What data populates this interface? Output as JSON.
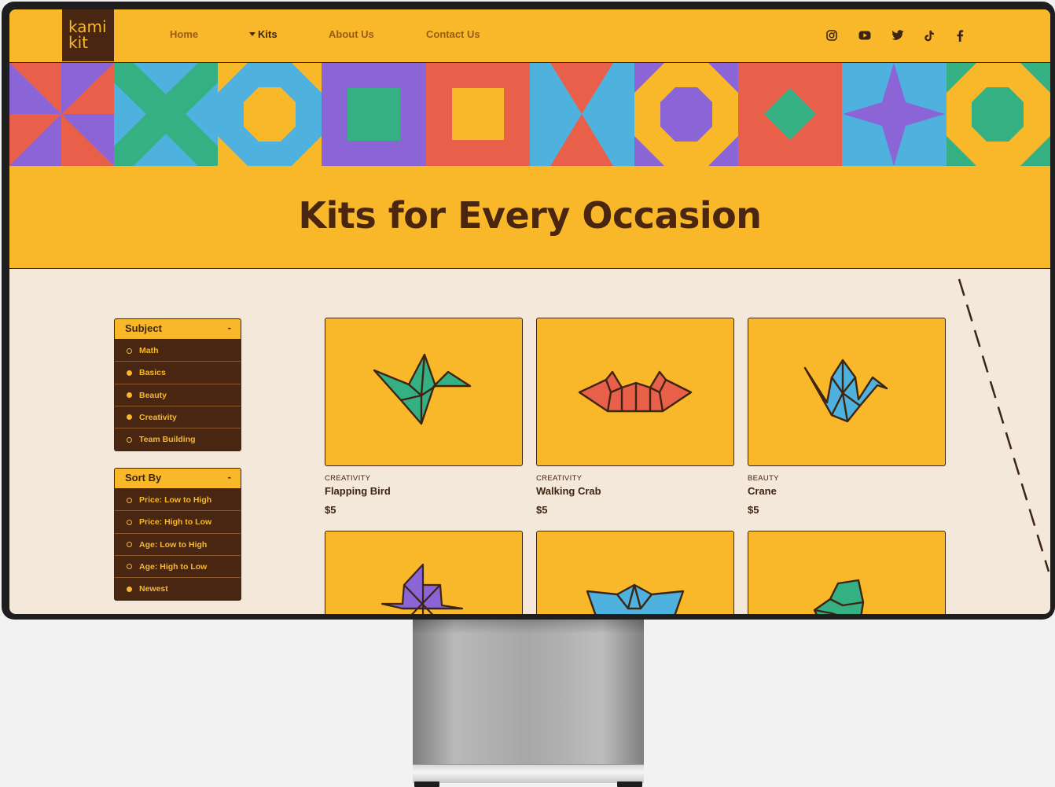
{
  "brand": {
    "logo_line1": "kami",
    "logo_line2": "kit"
  },
  "nav": {
    "links": [
      "Home",
      "Kits",
      "About Us",
      "Contact Us"
    ],
    "active": "Kits",
    "social_icons": [
      "instagram-icon",
      "youtube-icon",
      "twitter-icon",
      "tiktok-icon",
      "facebook-icon"
    ]
  },
  "headline": "Kits for Every Occasion",
  "filters": {
    "subject": {
      "title": "Subject",
      "toggle": "-",
      "options": [
        {
          "label": "Math",
          "selected": false
        },
        {
          "label": "Basics",
          "selected": true
        },
        {
          "label": "Beauty",
          "selected": true
        },
        {
          "label": "Creativity",
          "selected": true
        },
        {
          "label": "Team Building",
          "selected": false
        }
      ]
    },
    "sort": {
      "title": "Sort By",
      "toggle": "-",
      "options": [
        {
          "label": "Price: Low to High",
          "selected": false
        },
        {
          "label": "Price: High to Low",
          "selected": false
        },
        {
          "label": "Age: Low to High",
          "selected": false
        },
        {
          "label": "Age: High to Low",
          "selected": false
        },
        {
          "label": "Newest",
          "selected": true
        }
      ]
    }
  },
  "products": [
    {
      "category": "CREATIVITY",
      "name": "Flapping Bird",
      "price": "$5",
      "icon": "origami-bird-icon",
      "color": "#34b083"
    },
    {
      "category": "CREATIVITY",
      "name": "Walking Crab",
      "price": "$5",
      "icon": "origami-crab-icon",
      "color": "#e8604a"
    },
    {
      "category": "BEAUTY",
      "name": "Crane",
      "price": "$5",
      "icon": "origami-crane-icon",
      "color": "#4fb1de"
    },
    {
      "category": "",
      "name": "",
      "price": "",
      "icon": "origami-pinwheel-icon",
      "color": "#8b64d6"
    },
    {
      "category": "",
      "name": "",
      "price": "",
      "icon": "origami-boat-icon",
      "color": "#4fb1de"
    },
    {
      "category": "",
      "name": "",
      "price": "",
      "icon": "origami-animal-icon",
      "color": "#34b083"
    }
  ],
  "colors": {
    "primary": "#f8b82a",
    "dark": "#482611",
    "background": "#f3e8da",
    "red": "#e8604a",
    "green": "#34b083",
    "blue": "#4fb1de",
    "purple": "#8b64d6"
  }
}
